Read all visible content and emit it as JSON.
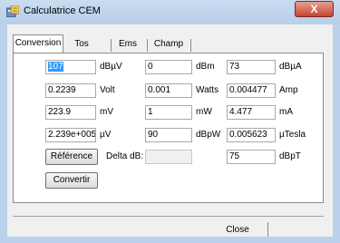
{
  "window": {
    "title": "Calculatrice CEM",
    "close_glyph": "X"
  },
  "tabs": [
    {
      "label": "Conversion"
    },
    {
      "label": "Tos"
    },
    {
      "label": "Ems"
    },
    {
      "label": "Champ"
    }
  ],
  "rows": [
    {
      "c1": {
        "value": "107",
        "unit": "dBµV"
      },
      "c2": {
        "value": "0",
        "unit": "dBm"
      },
      "c3": {
        "value": "73",
        "unit": "dBµA"
      }
    },
    {
      "c1": {
        "value": "0.2239",
        "unit": "Volt"
      },
      "c2": {
        "value": "0.001",
        "unit": "Watts"
      },
      "c3": {
        "value": "0.004477",
        "unit": "Amp"
      }
    },
    {
      "c1": {
        "value": "223.9",
        "unit": "mV"
      },
      "c2": {
        "value": "1",
        "unit": "mW"
      },
      "c3": {
        "value": "4.477",
        "unit": "mA"
      }
    },
    {
      "c1": {
        "value": "2.239e+005",
        "unit": "µV"
      },
      "c2": {
        "value": "90",
        "unit": "dBpW"
      },
      "c3": {
        "value": "0.005623",
        "unit": "µTesla"
      }
    }
  ],
  "reference": {
    "button_label": "Référence",
    "delta_label": "Delta dB:",
    "delta_value": "",
    "dbpt_value": "75",
    "dbpt_unit": "dBpT"
  },
  "convert_button": "Convertir",
  "footer": {
    "close_label": "Close"
  }
}
